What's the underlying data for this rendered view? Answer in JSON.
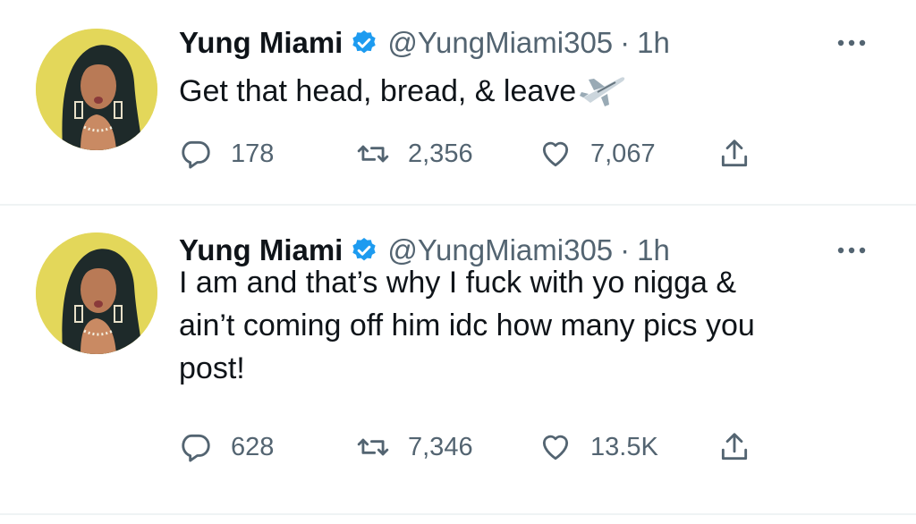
{
  "tweets": [
    {
      "name": "Yung Miami",
      "handle": "@YungMiami305",
      "separator": "·",
      "time": "1h",
      "text": "Get that head, bread, & leave",
      "emoji": "airplane-emoji",
      "replies": "178",
      "retweets": "2,356",
      "likes": "7,067"
    },
    {
      "name": "Yung Miami",
      "handle": "@YungMiami305",
      "separator": "·",
      "time": "1h",
      "text": "I am and that’s why I fuck with yo nigga &\nain’t coming off him idc how many pics you\npost!",
      "replies": "628",
      "retweets": "7,346",
      "likes": "13.5K"
    }
  ],
  "icons": {
    "verified": "verified-badge-icon",
    "more": "more-dots-icon",
    "reply": "reply-icon",
    "retweet": "retweet-icon",
    "like": "heart-icon",
    "share": "share-icon"
  },
  "colors": {
    "verified": "#1d9bf0",
    "text": "#0f1419",
    "secondary": "#536471",
    "divider": "#eff3f4",
    "avatar_bg": "#e3d75a"
  }
}
